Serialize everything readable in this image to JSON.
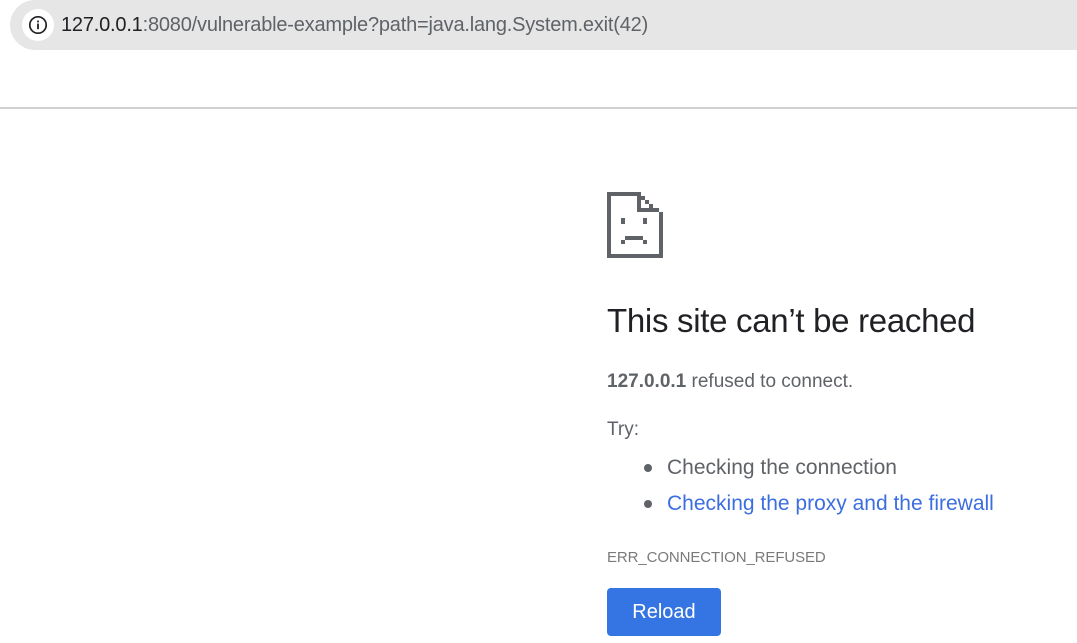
{
  "address_bar": {
    "icon": "info-icon",
    "url_host": "127.0.0.1",
    "url_rest": ":8080/vulnerable-example?path=java.lang.System.exit(42)"
  },
  "error_page": {
    "icon": "sad-document-icon",
    "heading": "This site can’t be reached",
    "host": "127.0.0.1",
    "message_suffix": " refused to connect.",
    "try_label": "Try:",
    "suggestions": [
      {
        "text": "Checking the connection",
        "is_link": false
      },
      {
        "text": "Checking the proxy and the firewall",
        "is_link": true
      }
    ],
    "error_code": "ERR_CONNECTION_REFUSED",
    "reload_label": "Reload"
  },
  "colors": {
    "link": "#3c6ee0",
    "button": "#3574e3",
    "text": "#5f6368",
    "heading": "#202124"
  }
}
